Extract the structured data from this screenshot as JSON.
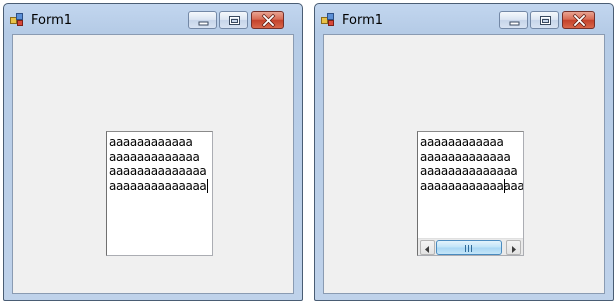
{
  "windows": [
    {
      "title": "Form1",
      "textbox": {
        "lines": [
          "aaaaaaaaaaaa",
          "aaaaaaaaaaaaa",
          "aaaaaaaaaaaaaa",
          "aaaaaaaaaaaaaa"
        ],
        "has_horizontal_scrollbar": false
      }
    },
    {
      "title": "Form1",
      "textbox": {
        "lines": [
          "aaaaaaaaaaaa",
          "aaaaaaaaaaaaa",
          "aaaaaaaaaaaaaa",
          "aaaaaaaaaaaaaaaa"
        ],
        "has_horizontal_scrollbar": true,
        "scroll_thumb_grip": "III"
      }
    }
  ],
  "icons": {
    "app": "form-app-icon",
    "minimize": "minimize-icon",
    "maximize": "maximize-icon",
    "close": "close-icon",
    "scroll_left": "chevron-left-icon",
    "scroll_right": "chevron-right-icon"
  },
  "colors": {
    "titlebar": "#c2d6ef",
    "client_background": "#f0f0f0",
    "close_button": "#c4422b",
    "scroll_thumb": "#bfe3f8"
  }
}
